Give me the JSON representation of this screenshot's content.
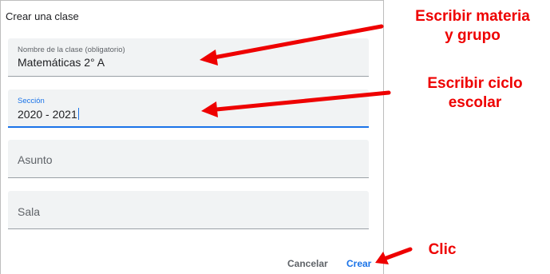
{
  "dialog": {
    "title": "Crear una clase",
    "fields": [
      {
        "label": "Nombre de la clase (obligatorio)",
        "value": "Matemáticas 2° A",
        "placeholder": ""
      },
      {
        "label": "Sección",
        "value": "2020 - 2021",
        "placeholder": ""
      },
      {
        "label": "",
        "value": "",
        "placeholder": "Asunto"
      },
      {
        "label": "",
        "value": "",
        "placeholder": "Sala"
      }
    ],
    "buttons": {
      "cancel": "Cancelar",
      "create": "Crear"
    }
  },
  "annotations": {
    "first_line1": "Escribir materia",
    "first_line2": "y grupo",
    "second_line1": "Escribir ciclo",
    "second_line2": "escolar",
    "third": "Clic"
  },
  "colors": {
    "accent": "#1a73e8",
    "annotation": "#ee0000",
    "field_background": "#f1f3f4"
  }
}
